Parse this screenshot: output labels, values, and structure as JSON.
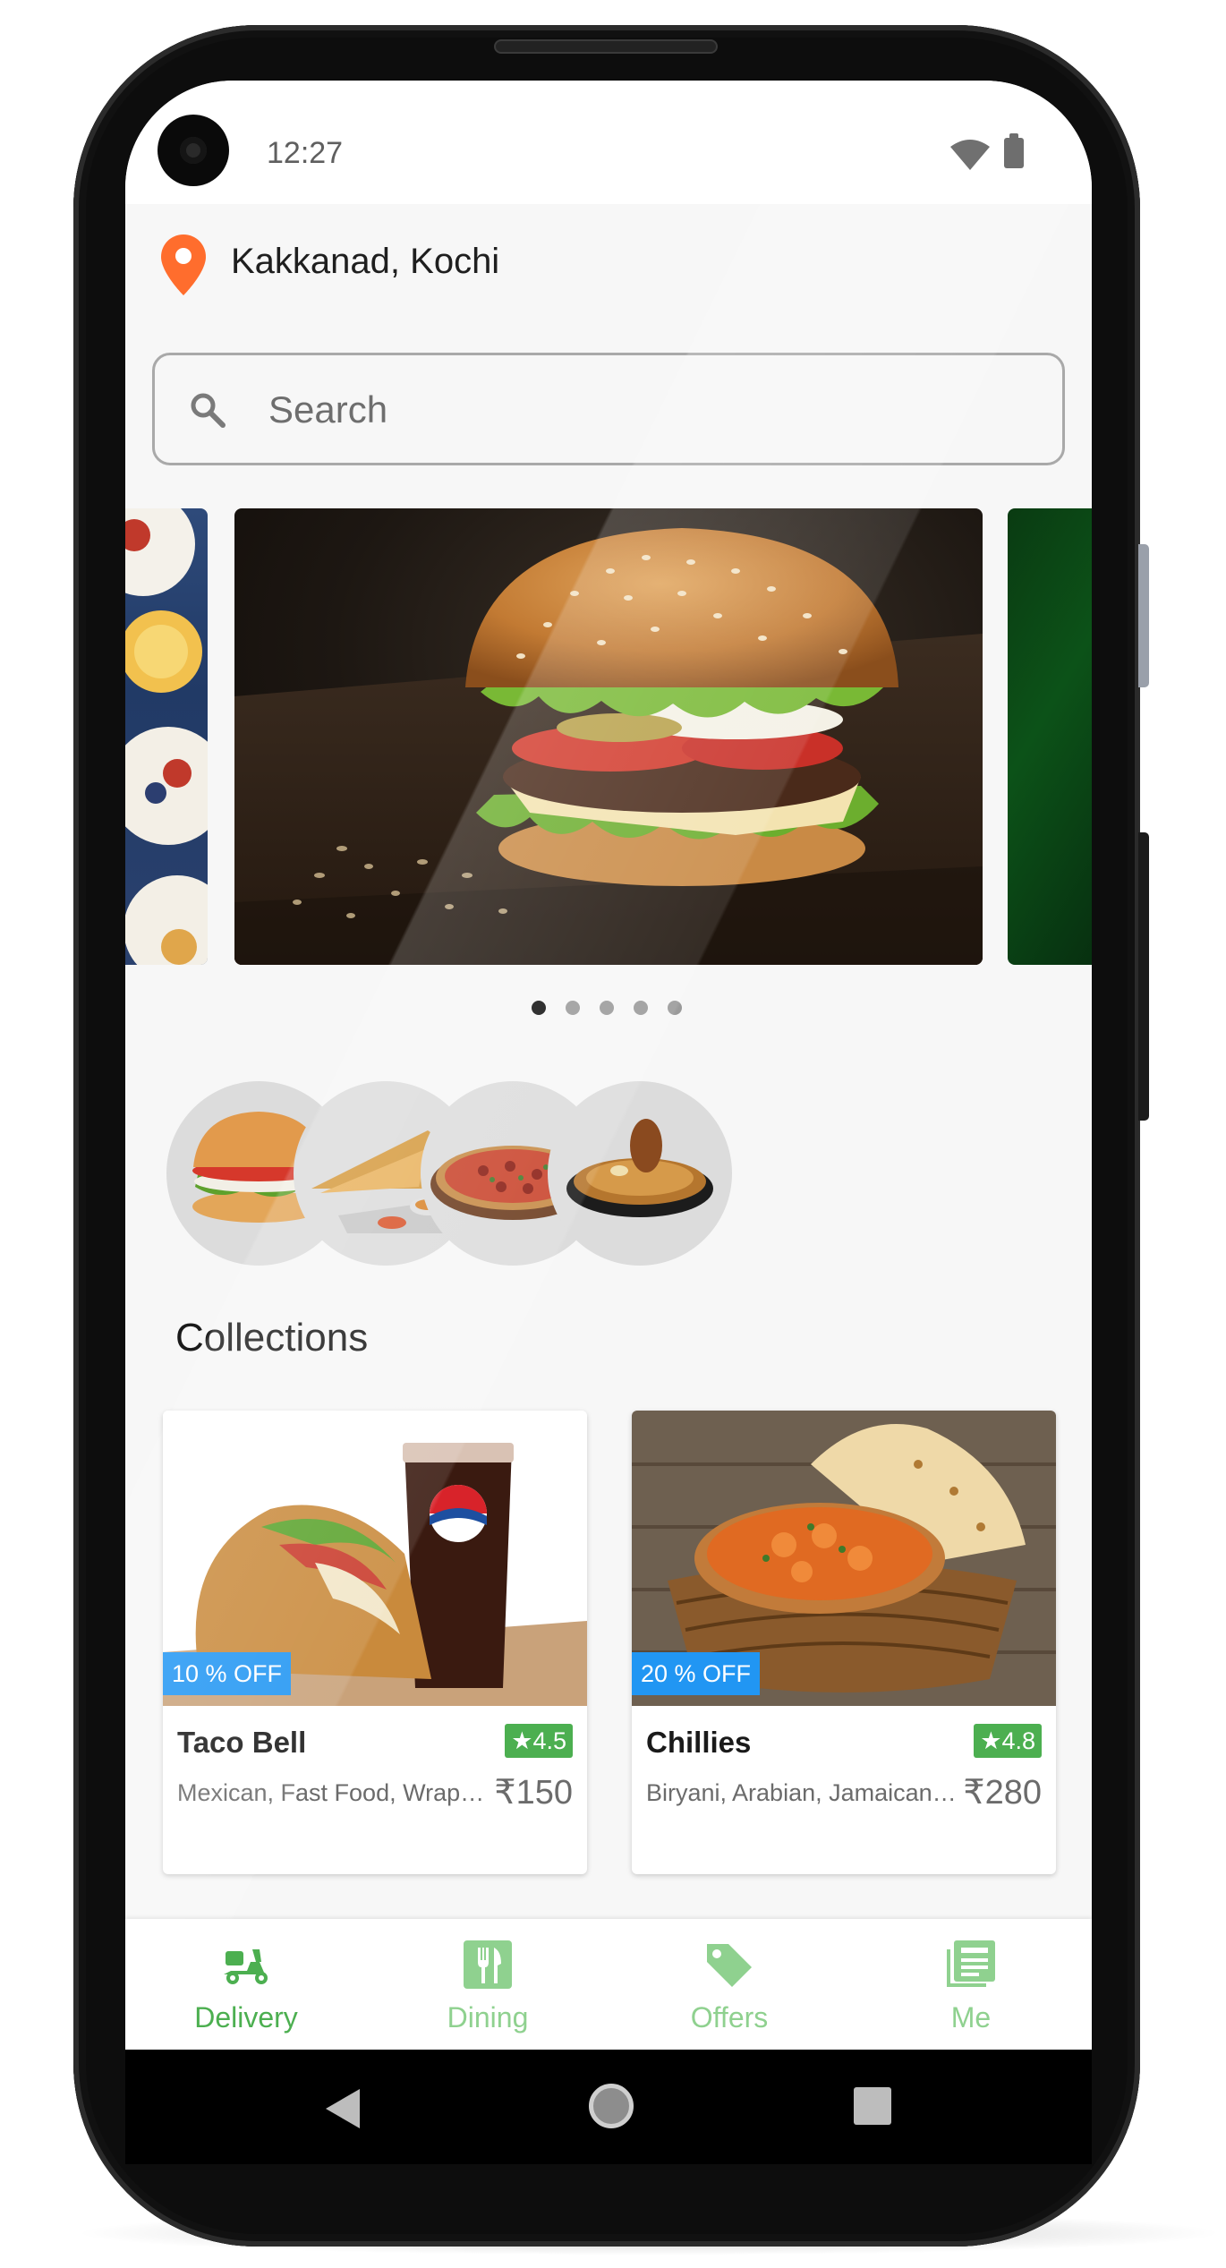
{
  "status_bar": {
    "time": "12:27"
  },
  "location": {
    "label": "Kakkanad, Kochi"
  },
  "search": {
    "placeholder": "Search"
  },
  "carousel": {
    "banners": [
      "breakfast-spread",
      "burger",
      "green-leaf"
    ],
    "active_index": 0,
    "page_count": 5
  },
  "categories": [
    "burger",
    "dosa",
    "pizza",
    "biryani"
  ],
  "collections": {
    "title": "Collections",
    "items": [
      {
        "name": "Taco Bell",
        "rating": "★4.5",
        "offer": "10 % OFF",
        "cuisine": "Mexican, Fast Food, Wraps, Beverages",
        "price": "₹150"
      },
      {
        "name": "Chillies",
        "rating": "★4.8",
        "offer": "20 % OFF",
        "cuisine": "Biryani, Arabian, Jamaican, Chinese",
        "price": "₹280"
      }
    ]
  },
  "bottom_nav": {
    "items": [
      {
        "label": "Delivery",
        "icon": "scooter-icon",
        "active": true
      },
      {
        "label": "Dining",
        "icon": "fork-knife-icon",
        "active": false
      },
      {
        "label": "Offers",
        "icon": "tag-icon",
        "active": false
      },
      {
        "label": "Me",
        "icon": "newspaper-icon",
        "active": false
      }
    ]
  },
  "colors": {
    "accent": "#4caf50",
    "accent_inactive": "#8fd18f",
    "offer_badge": "#2196f3",
    "pin": "#ff6d2d"
  }
}
